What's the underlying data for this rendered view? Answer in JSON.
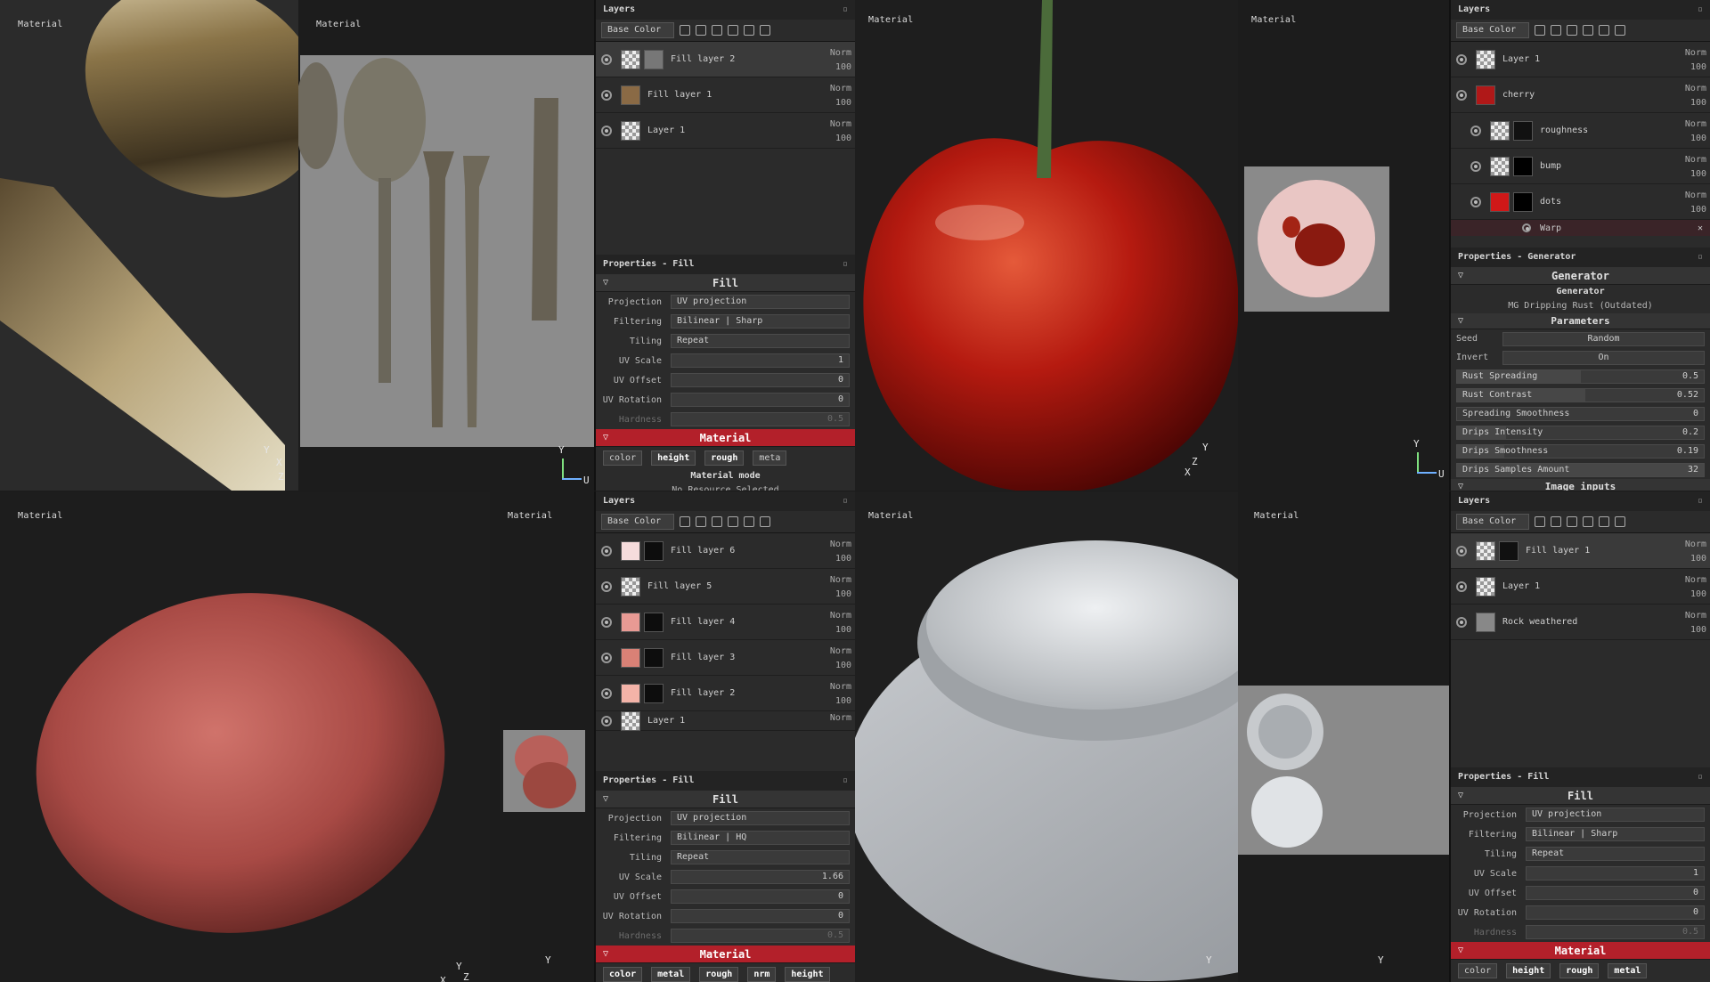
{
  "q1": {
    "view3d_label": "Material",
    "view2d_label": "Material",
    "axes3d": [
      "Y",
      "X",
      "Z"
    ],
    "axes2d": [
      "Y",
      "U"
    ],
    "layers_title": "Layers",
    "channel": "Base Color",
    "layers": [
      {
        "name": "Fill layer 2",
        "blend": "Norm",
        "opacity": "100"
      },
      {
        "name": "Fill layer 1",
        "blend": "Norm",
        "opacity": "100"
      },
      {
        "name": "Layer 1",
        "blend": "Norm",
        "opacity": "100"
      }
    ],
    "props_title": "Properties - Fill",
    "fill_section": "Fill",
    "props": [
      {
        "label": "Projection",
        "value": "UV projection"
      },
      {
        "label": "Filtering",
        "value": "Bilinear | Sharp"
      },
      {
        "label": "Tiling",
        "value": "Repeat"
      },
      {
        "label": "UV Scale",
        "value": "1",
        "value2": "1"
      },
      {
        "label": "UV Offset",
        "value": "0",
        "value2": "0"
      },
      {
        "label": "UV Rotation",
        "value": "0"
      },
      {
        "label": "Hardness",
        "value": "0.5"
      }
    ],
    "material_section": "Material",
    "chips": [
      "color",
      "height",
      "rough",
      "meta"
    ],
    "material_mode": "Material mode",
    "no_resource": "No Resource Selected"
  },
  "q2": {
    "view3d_label": "Material",
    "view2d_label": "Material",
    "axes3d": [
      "Y",
      "Z",
      "X"
    ],
    "axes2d": [
      "Y",
      "U"
    ],
    "layers_title": "Layers",
    "channel": "Base Color",
    "layers": [
      {
        "name": "Layer 1",
        "blend": "Norm",
        "opacity": "100"
      },
      {
        "name": "cherry",
        "blend": "Norm",
        "opacity": "100"
      },
      {
        "name": "roughness",
        "blend": "Norm",
        "opacity": "100"
      },
      {
        "name": "bump",
        "blend": "Norm",
        "opacity": "100"
      },
      {
        "name": "dots",
        "blend": "Norm",
        "opacity": "100"
      }
    ],
    "warp": "Warp",
    "props_title": "Properties - Generator",
    "gen_section": "Generator",
    "gen_name": "Generator",
    "gen_resource": "MG Dripping Rust (Outdated)",
    "params_section": "Parameters",
    "params": [
      {
        "label": "Seed",
        "value": "Random"
      },
      {
        "label": "Invert",
        "value": "On"
      },
      {
        "label": "Rust Spreading",
        "value": "0.5"
      },
      {
        "label": "Rust Contrast",
        "value": "0.52"
      },
      {
        "label": "Spreading Smoothness",
        "value": "0"
      },
      {
        "label": "Drips Intensity",
        "value": "0.2"
      },
      {
        "label": "Drips Smoothness",
        "value": "0.19"
      },
      {
        "label": "Drips Samples Amount",
        "value": "32"
      }
    ],
    "image_inputs": "Image inputs"
  },
  "q3": {
    "view3d_label": "Material",
    "view2d_label": "Material",
    "axes3d": [
      "Y",
      "Z",
      "X"
    ],
    "axes2d": [
      "Y"
    ],
    "layers_title": "Layers",
    "channel": "Base Color",
    "layers": [
      {
        "name": "Fill layer 6",
        "blend": "Norm",
        "opacity": "100"
      },
      {
        "name": "Fill layer 5",
        "blend": "Norm",
        "opacity": "100"
      },
      {
        "name": "Fill layer 4",
        "blend": "Norm",
        "opacity": "100"
      },
      {
        "name": "Fill layer 3",
        "blend": "Norm",
        "opacity": "100"
      },
      {
        "name": "Fill layer 2",
        "blend": "Norm",
        "opacity": "100"
      },
      {
        "name": "Layer 1",
        "blend": "Norm",
        "opacity": ""
      }
    ],
    "props_title": "Properties - Fill",
    "fill_section": "Fill",
    "props": [
      {
        "label": "Projection",
        "value": "UV projection"
      },
      {
        "label": "Filtering",
        "value": "Bilinear | HQ"
      },
      {
        "label": "Tiling",
        "value": "Repeat"
      },
      {
        "label": "UV Scale",
        "value": "1.66",
        "value2": "1.66"
      },
      {
        "label": "UV Offset",
        "value": "0",
        "value2": "0"
      },
      {
        "label": "UV Rotation",
        "value": "0"
      },
      {
        "label": "Hardness",
        "value": "0.5"
      }
    ],
    "material_section": "Material",
    "chips": [
      "color",
      "metal",
      "rough",
      "nrm",
      "height"
    ]
  },
  "q4": {
    "view3d_label": "Material",
    "view2d_label": "Material",
    "axes3d": [
      "Y"
    ],
    "axes2d": [
      "Y"
    ],
    "layers_title": "Layers",
    "channel": "Base Color",
    "layers": [
      {
        "name": "Fill layer 1",
        "blend": "Norm",
        "opacity": "100"
      },
      {
        "name": "Layer 1",
        "blend": "Norm",
        "opacity": "100"
      },
      {
        "name": "Rock weathered",
        "blend": "Norm",
        "opacity": "100"
      }
    ],
    "props_title": "Properties - Fill",
    "fill_section": "Fill",
    "props": [
      {
        "label": "Projection",
        "value": "UV projection"
      },
      {
        "label": "Filtering",
        "value": "Bilinear | Sharp"
      },
      {
        "label": "Tiling",
        "value": "Repeat"
      },
      {
        "label": "UV Scale",
        "value": "1",
        "value2": "1"
      },
      {
        "label": "UV Offset",
        "value": "0",
        "value2": "0"
      },
      {
        "label": "UV Rotation",
        "value": "0"
      },
      {
        "label": "Hardness",
        "value": "0.5"
      }
    ],
    "material_section": "Material",
    "chips": [
      "color",
      "height",
      "rough",
      "metal"
    ]
  }
}
